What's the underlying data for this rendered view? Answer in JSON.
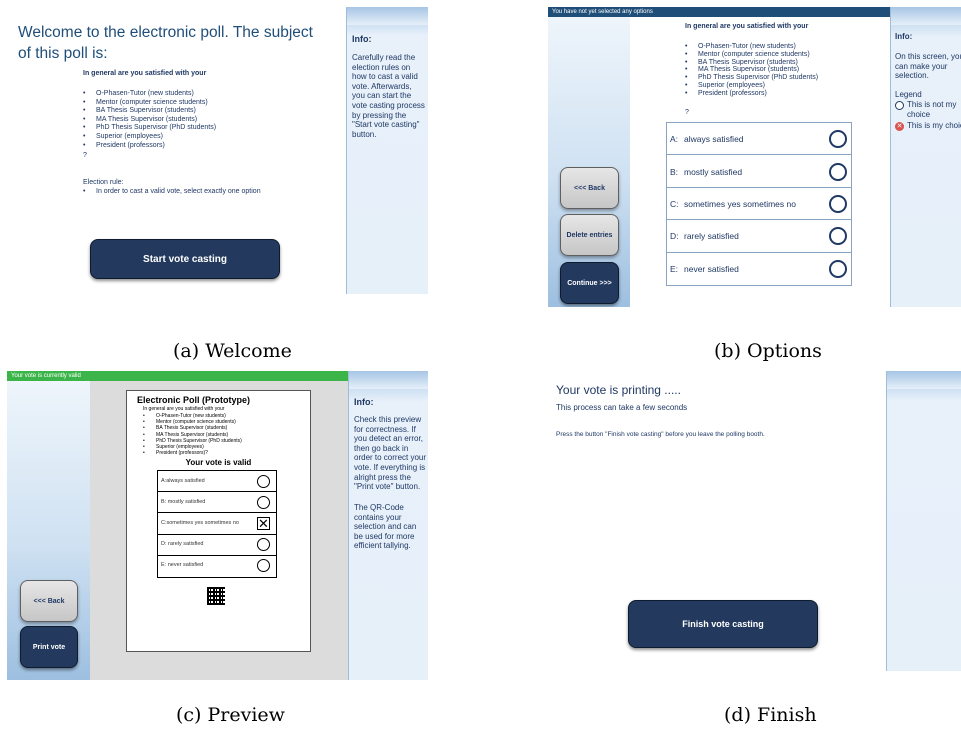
{
  "welcome": {
    "heading": "Welcome to the electronic poll. The subject of this poll is:",
    "question": "In general are you satisfied with your",
    "roles": [
      "O-Phasen-Tutor (new students)",
      "Mentor (computer science students)",
      "BA Thesis Supervisor (students)",
      "MA Thesis Supervisor (students)",
      "PhD Thesis Supervisor (PhD students)",
      "Superior (employees)",
      "President (professors)"
    ],
    "question_mark": "?",
    "rule_title": "Election rule:",
    "rule_item": "In order to cast a valid vote, select exactly one option",
    "start_button": "Start vote casting",
    "info_title": "Info:",
    "info_text": "Carefully read the election rules on how to cast a valid vote. Afterwards, you can start the vote casting process by pressing the \"Start vote casting\" button.",
    "caption": "(a) Welcome"
  },
  "options": {
    "status": "You have not yet selected any options",
    "question": "In general are you satisfied with your",
    "roles": [
      "O-Phasen-Tutor (new students)",
      "Mentor (computer science students)",
      "BA Thesis Supervisor (students)",
      "MA Thesis Supervisor (students)",
      "PhD Thesis Supervisor (PhD students)",
      "Superior (employees)",
      "President (professors)"
    ],
    "question_mark": "?",
    "choices": [
      {
        "letter": "A:",
        "label": "always satisfied"
      },
      {
        "letter": "B:",
        "label": "mostly satisfied"
      },
      {
        "letter": "C:",
        "label": "sometimes yes sometimes no"
      },
      {
        "letter": "D:",
        "label": "rarely satisfied"
      },
      {
        "letter": "E:",
        "label": "never satisfied"
      }
    ],
    "back_button": "<<< Back",
    "delete_button": "Delete entries",
    "continue_button": "Continue >>>",
    "info_title": "Info:",
    "info_text": "On this screen, you can make your selection.",
    "legend_title": "Legend",
    "legend_not": "This is not my choice",
    "legend_is": "This is my choice",
    "caption": "(b) Options"
  },
  "preview": {
    "status": "Your vote is currently valid",
    "doc_title": "Electronic Poll (Prototype)",
    "question": "In general are you satisfied with your",
    "roles": [
      "O-Phasen-Tutor (new students)",
      "Mentor (computer science students)",
      "BA Thesis Supervisor (students)",
      "MA Thesis Supervisor (students)",
      "PhD Thesis Supervisor (PhD students)",
      "Superior (employees)",
      "President (professors)?"
    ],
    "valid_text": "Your vote is valid",
    "choices": [
      {
        "label": "A:always satisfied",
        "checked": false
      },
      {
        "label": "B: mostly satisfied",
        "checked": false
      },
      {
        "label": "C:sometimes yes sometimes no",
        "checked": true
      },
      {
        "label": "D: rarely satisfied",
        "checked": false
      },
      {
        "label": "E:  never satisfied",
        "checked": false
      }
    ],
    "back_button": "<<< Back",
    "print_button": "Print vote",
    "info_title": "Info:",
    "info_text": "Check this preview for correctness. If you detect an error, then go back in order to correct your vote. If everything is alright press the \"Print vote\" button.",
    "info_text2": "The QR-Code contains your selection and can be used for more efficient tallying.",
    "caption": "(c) Preview"
  },
  "finish": {
    "heading": "Your vote is printing .....",
    "subheading": "This process can take a few seconds",
    "instruction": "Press the button \"Finish vote casting\" before you leave the polling booth.",
    "finish_button": "Finish vote casting",
    "caption": "(d) Finish"
  },
  "colors": {
    "navy": "#233a5e",
    "text": "#1f3864",
    "status_blue": "#1f4e79",
    "status_green": "#3bb54a",
    "info_bg": "#e6f0f9"
  }
}
